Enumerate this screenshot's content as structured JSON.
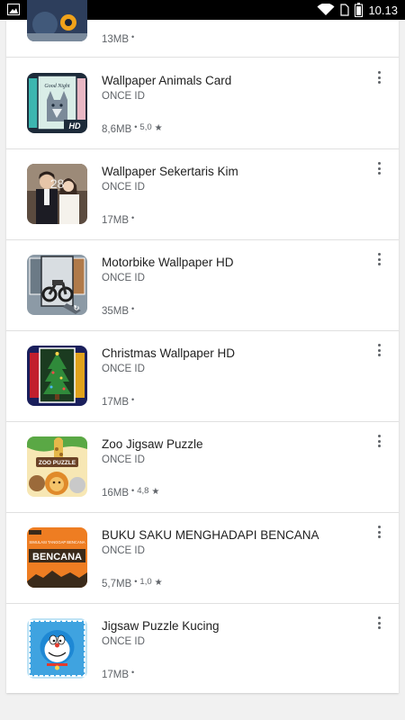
{
  "status_bar": {
    "time": "10.13",
    "icons": [
      "image-notification-icon",
      "wifi-icon",
      "sim-icon",
      "battery-icon"
    ]
  },
  "top_partial_item": {
    "size": "13MB",
    "separator": "•"
  },
  "apps": [
    {
      "title": "Wallpaper Animals Card",
      "developer": "ONCE ID",
      "size": "8,6MB",
      "separator": "•",
      "rating": "5,0",
      "star": "★",
      "icon": "wolf-good-night-thumbnail"
    },
    {
      "title": "Wallpaper Sekertaris Kim",
      "developer": "ONCE ID",
      "size": "17MB",
      "separator": "•",
      "rating": "",
      "star": "",
      "icon": "couple-photo-thumbnail"
    },
    {
      "title": "Motorbike Wallpaper HD",
      "developer": "ONCE ID",
      "size": "35MB",
      "separator": "•",
      "rating": "",
      "star": "",
      "icon": "motorbike-thumbnail"
    },
    {
      "title": "Christmas Wallpaper HD",
      "developer": "ONCE ID",
      "size": "17MB",
      "separator": "•",
      "rating": "",
      "star": "",
      "icon": "christmas-tree-thumbnail"
    },
    {
      "title": "Zoo Jigsaw Puzzle",
      "developer": "ONCE ID",
      "size": "16MB",
      "separator": "•",
      "rating": "4,8",
      "star": "★",
      "icon": "zoo-puzzle-thumbnail"
    },
    {
      "title": "BUKU SAKU MENGHADAPI BENCANA",
      "developer": "ONCE ID",
      "size": "5,7MB",
      "separator": "•",
      "rating": "1,0",
      "star": "★",
      "icon": "bencana-thumbnail"
    },
    {
      "title": "Jigsaw Puzzle Kucing",
      "developer": "ONCE ID",
      "size": "17MB",
      "separator": "•",
      "rating": "",
      "star": "",
      "icon": "doraemon-puzzle-thumbnail"
    }
  ],
  "thumbnail_text": {
    "wolf_greeting": "Good Night",
    "wolf_badge": "HD",
    "clock": "28",
    "zoo_sign": "ZOO PUZZLE",
    "bencana_header": "SIMULASI TANGGAP BENCANA",
    "bencana_title": "BENCANA"
  },
  "colors": {
    "background": "#f1f1f1",
    "card": "#ffffff",
    "title_text": "#212121",
    "secondary_text": "#5f6368",
    "divider": "#e0e0e0"
  }
}
